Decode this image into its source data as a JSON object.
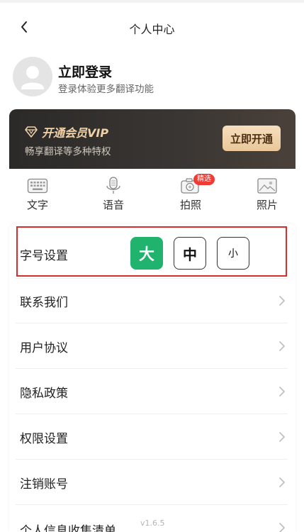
{
  "header": {
    "title": "个人中心"
  },
  "profile": {
    "login_title": "立即登录",
    "login_subtitle": "登录体验更多翻译功能"
  },
  "vip": {
    "title": "开通会员VIP",
    "subtitle": "畅享翻译等多种特权",
    "button_label": "立即开通"
  },
  "modes": [
    {
      "label": "文字"
    },
    {
      "label": "语音"
    },
    {
      "label": "拍照",
      "badge": "精选"
    },
    {
      "label": "照片"
    }
  ],
  "font_size": {
    "label": "字号设置",
    "options": [
      "大",
      "中",
      "小"
    ],
    "selected": "大"
  },
  "settings_items": [
    {
      "label": "联系我们"
    },
    {
      "label": "用户协议"
    },
    {
      "label": "隐私政策"
    },
    {
      "label": "权限设置"
    },
    {
      "label": "注销账号"
    },
    {
      "label": "个人信息收集清单"
    }
  ],
  "version": "v1.6.5",
  "colors": {
    "accent_green": "#1fb36d",
    "highlight_red": "#d92c2c",
    "vip_gold": "#f0d1a8"
  }
}
